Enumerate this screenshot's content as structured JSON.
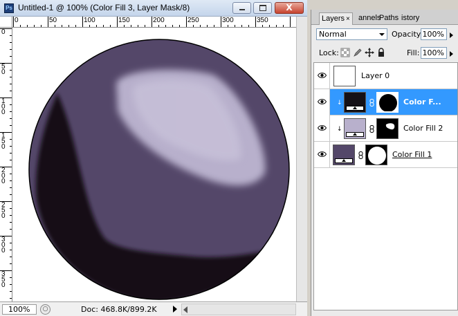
{
  "window": {
    "app_icon_text": "Ps",
    "title": "Untitled-1 @ 100% (Color Fill 3, Layer Mask/8)",
    "close_glyph": "X"
  },
  "rulers": {
    "top_labels": [
      "0",
      "50",
      "100",
      "150",
      "200",
      "250",
      "300",
      "350"
    ],
    "left_labels": [
      "0",
      "50",
      "100",
      "150",
      "200",
      "250",
      "300",
      "350"
    ]
  },
  "canvas": {
    "sphere_base_color": "#544769",
    "shadow_color": "#151117",
    "highlight_color": "#b8b0cc",
    "highlight_core_color": "#cfc9df",
    "outline_color": "#000000"
  },
  "status": {
    "zoom": "100%",
    "doc_info": "Doc: 468.8K/899.2K"
  },
  "panel": {
    "tabs": [
      {
        "label": "Layers",
        "active": true,
        "close": "×"
      },
      {
        "label": "annels",
        "active": false
      },
      {
        "label": "Paths",
        "active": false
      },
      {
        "label": "istory",
        "active": false
      }
    ],
    "blend_mode": "Normal",
    "opacity_label": "Opacity:",
    "opacity_value": "100%",
    "lock_label": "Lock:",
    "fill_label": "Fill:",
    "fill_value": "100%",
    "layers": [
      {
        "name": "Layer 0",
        "selected": false,
        "thumb_color": "#ffffff",
        "has_mask": false,
        "clipped": false
      },
      {
        "name": "Color F...",
        "selected": true,
        "thumb_color": "#151117",
        "has_mask": true,
        "clipped": true
      },
      {
        "name": "Color Fill 2",
        "selected": false,
        "thumb_color": "#b8b0cc",
        "has_mask": true,
        "clipped": true
      },
      {
        "name": "Color Fill 1",
        "selected": false,
        "thumb_color": "#544769",
        "has_mask": true,
        "clipped": false
      }
    ],
    "clip_glyph": "↓",
    "accent_color": "#3399ff"
  }
}
